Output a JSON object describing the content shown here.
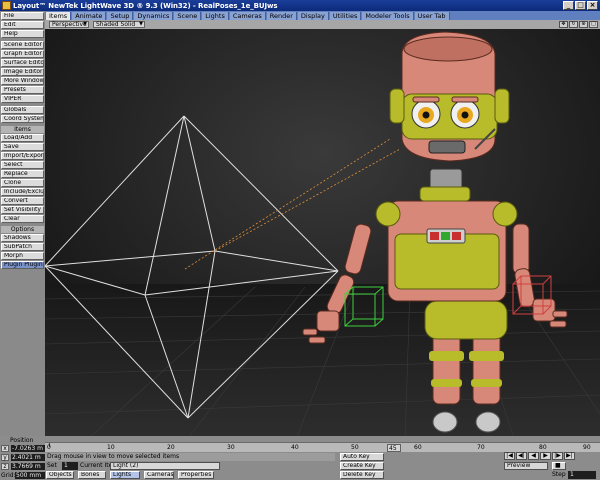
{
  "window": {
    "title": "Layout™ NewTek LightWave 3D ® 9.3 (Win32) - RealPoses_1e_BUJws",
    "buttons": [
      "_",
      "□",
      "×"
    ]
  },
  "left_panel": {
    "group1": [
      "File",
      "Edit",
      "Help"
    ],
    "group2": [
      "Scene Editor",
      "Graph Editor",
      "Surface Editor",
      "Image Editor",
      "More Windows",
      "Presets",
      "VIPER"
    ],
    "group3": [
      "Globals",
      "Coord System"
    ],
    "items_header": "Items",
    "items": [
      "Load/Add",
      "Save",
      "Import/Export",
      "Select",
      "Replace",
      "Clone",
      "Include/Exclude",
      "Convert",
      "Set Visibility",
      "Clear"
    ],
    "options_header": "Options",
    "options": [
      "Shadows",
      "SubPatch",
      "Morph",
      "Plugin Plugins"
    ]
  },
  "tabs": [
    "Items",
    "Animate",
    "Setup",
    "Dynamics",
    "Scene",
    "Lights",
    "Cameras",
    "Render",
    "Display",
    "Utilities",
    "Modeler Tools",
    "User Tab"
  ],
  "viewport_toolbar": {
    "view_mode": "Perspective",
    "shading": "Shaded Solid",
    "icons": [
      "move-view-icon",
      "rotate-view-icon",
      "zoom-view-icon",
      "maximize-view-icon"
    ]
  },
  "position": {
    "header": "Position",
    "x": "-7.0263 m",
    "y": "2.4021 m",
    "z": "3.7669 m",
    "grid_label": "Grid:",
    "grid": "500 mm"
  },
  "timeline": {
    "ticks": [
      "0",
      "10",
      "20",
      "30",
      "40",
      "50",
      "60",
      "70",
      "80"
    ],
    "end": "90",
    "current": "45"
  },
  "status": {
    "message": "Drag mouse in view to move selected items",
    "set_label": "Set",
    "set_value": "1",
    "current_item_label": "Current Item",
    "current_item": "Light (2)",
    "modes": [
      "Objects",
      "Bones",
      "Lights",
      "Cameras",
      "Properties"
    ]
  },
  "keys": {
    "auto_key": "Auto Key",
    "create_key": "Create Key",
    "delete_key": "Delete Key"
  },
  "playback": {
    "preview": "Preview",
    "step_label": "Step",
    "step_value": "1",
    "transport": [
      "|◀",
      "◀|",
      "◀",
      "▶",
      "|▶",
      "▶|"
    ]
  },
  "colors": {
    "title_bar": "#1a3e9a",
    "tab_bar": "#5f7fbf",
    "viewport_bg": "#101010",
    "robot_body": "#d88878",
    "robot_accent": "#b8bc2a",
    "camera_lines": "#e0e0e0",
    "light_line": "#e0903a",
    "selection_green": "#3fcf3f",
    "selection_red": "#cf3f3f"
  }
}
